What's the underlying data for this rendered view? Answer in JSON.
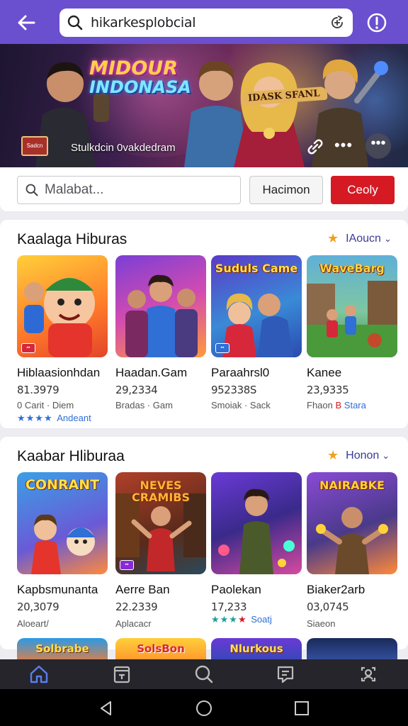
{
  "topbar": {
    "search_query": "hikarkesplobcial",
    "back_icon": "arrow-left-icon",
    "info_icon": "alert-circle-icon",
    "bg_color": "#6a4fcf"
  },
  "hero": {
    "title_line1": "MIDOUR",
    "title_line2": "INDONASA",
    "badge": "IDASK SFANL",
    "subtitle": "Stulkdcin 0vakdedram",
    "logo_text": "Sadcn"
  },
  "filters": {
    "search_placeholder": "Malabat...",
    "button1_label": "Hacimon",
    "button2_label": "Ceoly",
    "accent_color": "#d51a24"
  },
  "sections": [
    {
      "title": "Kaalaga Hiburas",
      "more_label": "IAoucn",
      "cards": [
        {
          "tile_title": "",
          "name": "Hiblaasionhdan",
          "number": "81.3979",
          "meta": "0 Carit · Diem",
          "stars": "★★★★",
          "rating_label": "Andeant"
        },
        {
          "tile_title": "",
          "name": "Haadan.Gam",
          "number": "29,2334",
          "meta": "Bradas · Gam",
          "stars": "",
          "rating_label": ""
        },
        {
          "tile_title": "Suduls Came",
          "name": "Paraahrsl0",
          "number": "952338S",
          "meta": "Smoiak · Sack",
          "stars": "",
          "rating_label": ""
        },
        {
          "tile_title": "WaveBarg",
          "name": "Kanee",
          "number": "23,9335",
          "meta_prefix": "Fhaon",
          "meta_red": "B",
          "meta_blue": "Stara",
          "stars": "",
          "rating_label": ""
        }
      ]
    },
    {
      "title": "Kaabar Hliburaa",
      "more_label": "Honon",
      "cards": [
        {
          "tile_title": "CONRANT",
          "name": "Kapbsmunanta",
          "number": "20,3079",
          "meta": "Aloeart/",
          "stars": "",
          "rating_label": ""
        },
        {
          "tile_title": "NEVES CRAMIBS",
          "name": "Aerre Ban",
          "number": "22.2339",
          "meta": "Aplacacr",
          "stars": "",
          "rating_label": ""
        },
        {
          "tile_title": "",
          "name": "Paolekan",
          "number": "17,233",
          "meta": "",
          "stars": "★★★",
          "stars_extra": "★",
          "rating_label": "Soatj"
        },
        {
          "tile_title": "NAIRABKE",
          "name": "Biaker2arb",
          "number": "03,0745",
          "meta": "Siaeon",
          "stars": "",
          "rating_label": ""
        }
      ]
    }
  ],
  "peek_row": [
    "Solbrabe",
    "SolsBon",
    "Nlurkous",
    ""
  ],
  "bottom_nav": [
    {
      "icon": "home-icon",
      "active": true
    },
    {
      "icon": "calendar-icon",
      "active": false
    },
    {
      "icon": "search-icon",
      "active": false
    },
    {
      "icon": "chat-icon",
      "active": false
    },
    {
      "icon": "profile-icon",
      "active": false
    }
  ],
  "system_nav": [
    "back-triangle-icon",
    "home-circle-icon",
    "recents-square-icon"
  ]
}
